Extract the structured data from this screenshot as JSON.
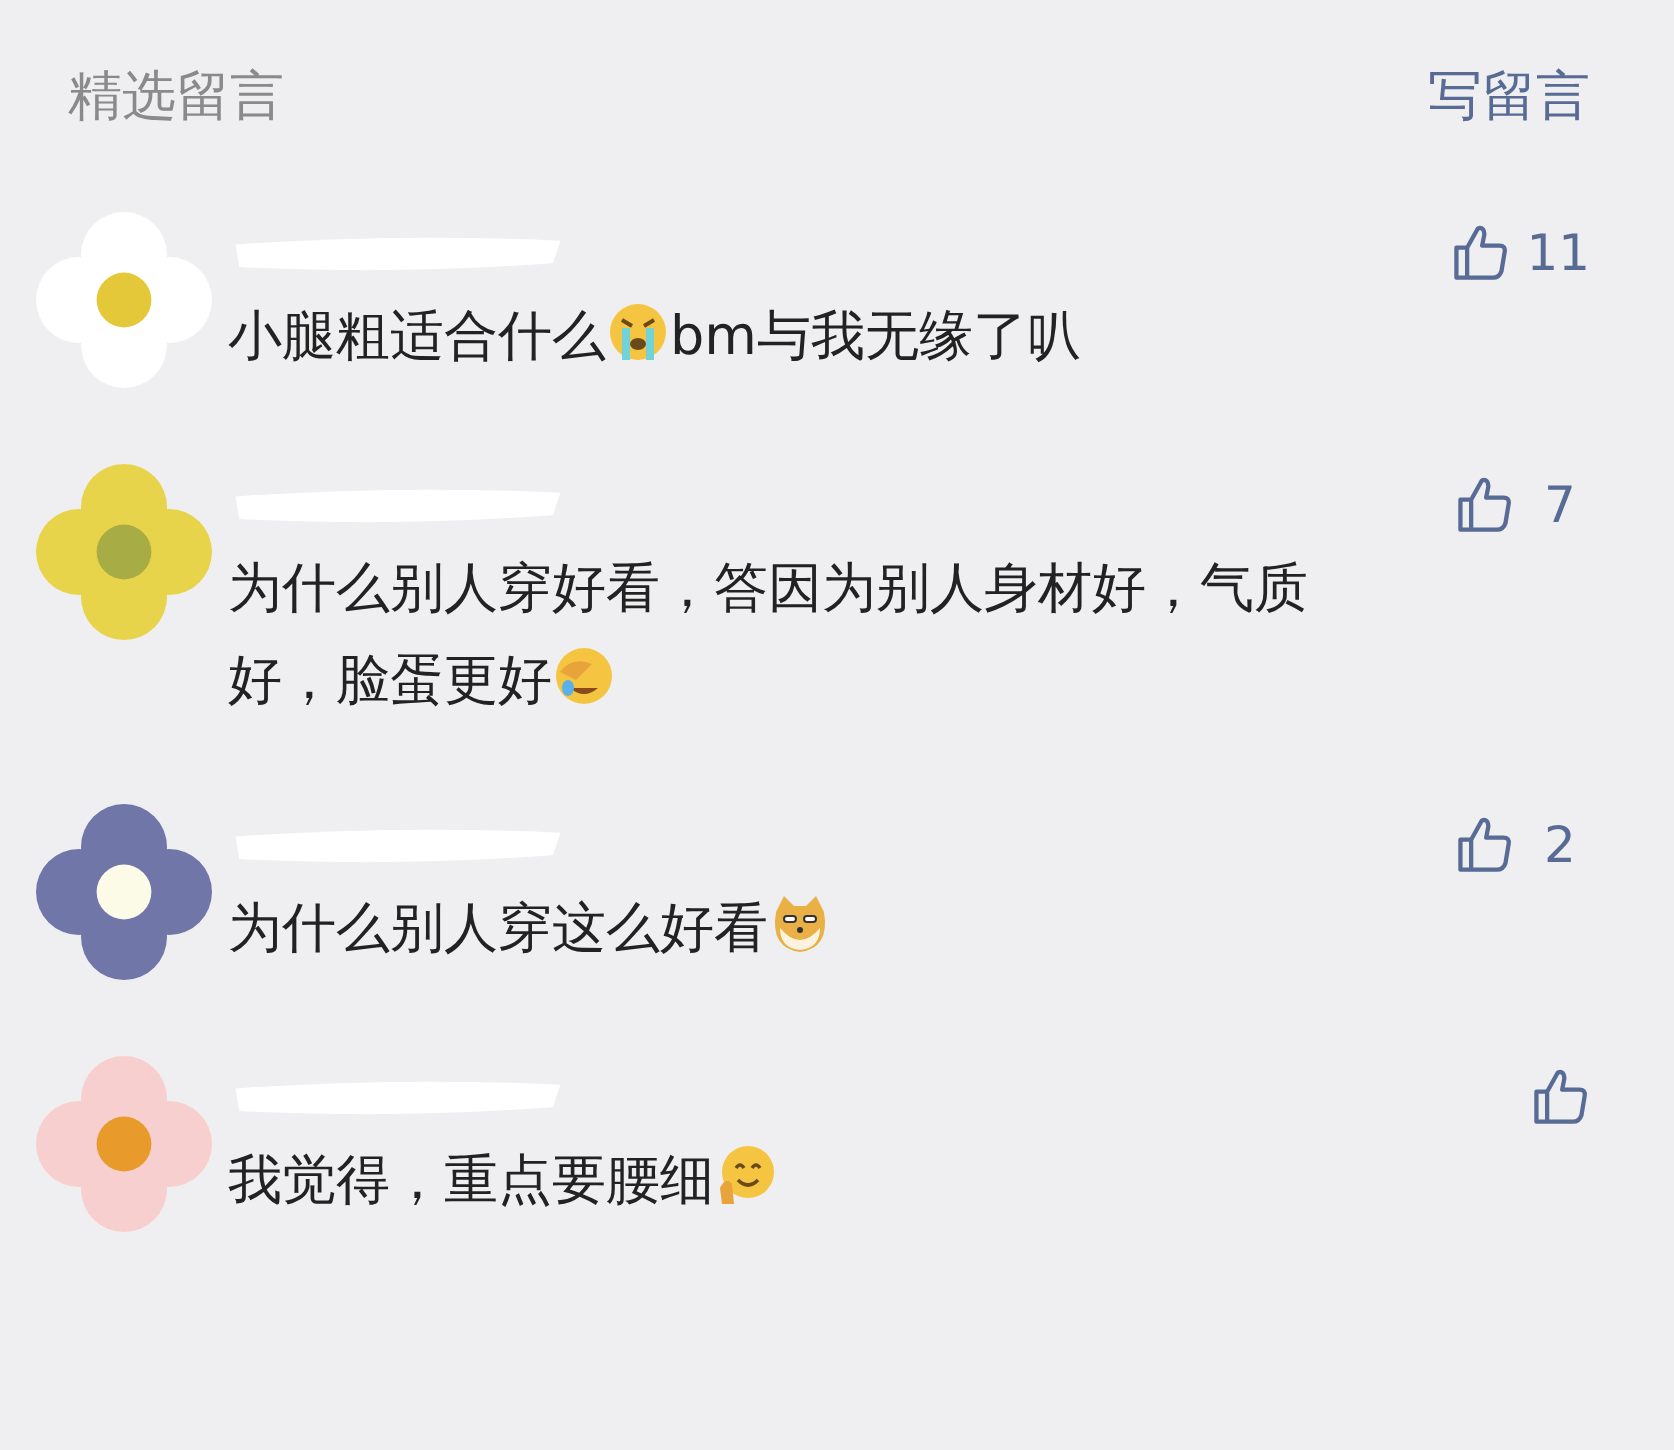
{
  "header": {
    "title": "精选留言",
    "action": "写留言"
  },
  "comments": [
    {
      "avatar": {
        "color": "#ffffff",
        "center": {
          "color": "#e5c83a"
        }
      },
      "likes": "11",
      "lines": [
        [
          {
            "kind": "text",
            "text": "小腿粗适合什么"
          },
          {
            "kind": "cry"
          },
          {
            "kind": "text",
            "text": "bm与我无缘了叭"
          }
        ]
      ]
    },
    {
      "avatar": {
        "color": "#e8d44a",
        "center": {
          "color": "#a8ac45"
        }
      },
      "likes": "7",
      "lines": [
        [
          {
            "kind": "text",
            "text": "为什么别人穿好看，答因为别人身材好，气质"
          }
        ],
        [
          {
            "kind": "text",
            "text": "好，脸蛋更好"
          },
          {
            "kind": "facepalm"
          }
        ]
      ]
    },
    {
      "avatar": {
        "color": "#7176a8",
        "center": {
          "color": "#fbfbe8"
        }
      },
      "likes": "2",
      "lines": [
        [
          {
            "kind": "text",
            "text": "为什么别人穿这么好看"
          },
          {
            "kind": "doge"
          }
        ]
      ]
    },
    {
      "avatar": {
        "color": "#f8cfcf",
        "center": {
          "color": "#e89a2a"
        }
      },
      "lines": [
        [
          {
            "kind": "text",
            "text": "我觉得，重点要腰细"
          },
          {
            "kind": "think"
          }
        ]
      ]
    }
  ]
}
